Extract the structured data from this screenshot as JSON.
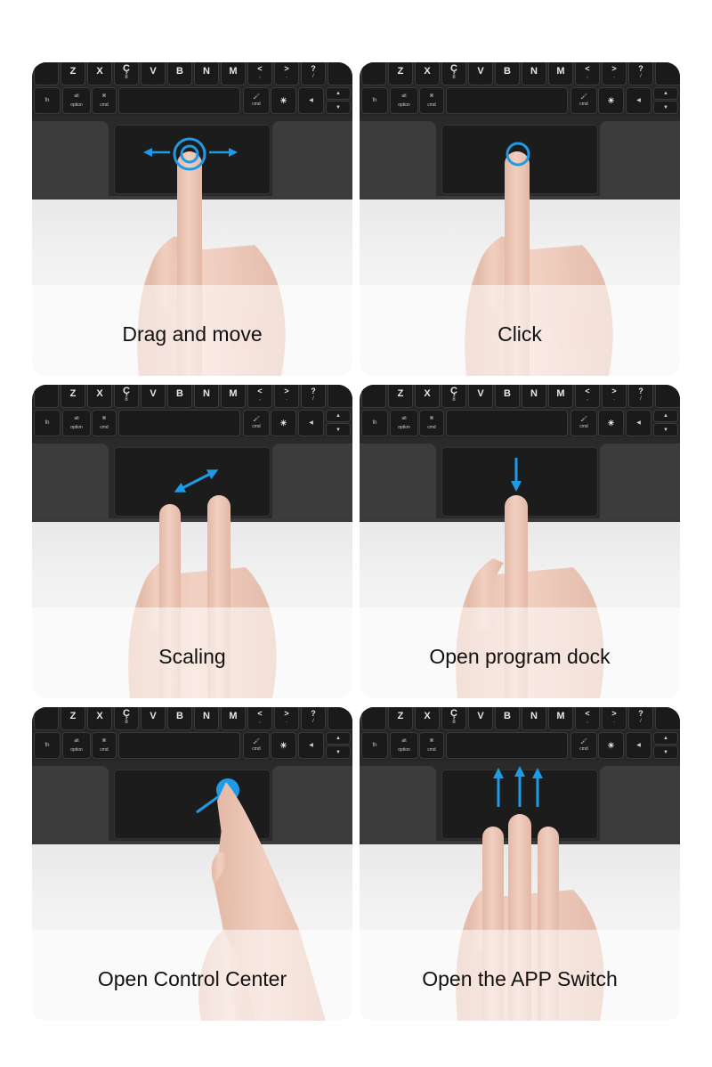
{
  "keyboard": {
    "row1": [
      {
        "main": "",
        "sub": ""
      },
      {
        "main": "Z",
        "sub": ""
      },
      {
        "main": "X",
        "sub": ""
      },
      {
        "main": "Ç",
        "sub": "8"
      },
      {
        "main": "V",
        "sub": ""
      },
      {
        "main": "B",
        "sub": ""
      },
      {
        "main": "N",
        "sub": ""
      },
      {
        "main": "M",
        "sub": ""
      },
      {
        "main": "<",
        "sub": ","
      },
      {
        "main": ">",
        "sub": "."
      },
      {
        "main": "?",
        "sub": "/"
      },
      {
        "main": "",
        "sub": ""
      }
    ],
    "row2": {
      "fn": "fn",
      "alt_top": "alt",
      "alt_bottom": "option",
      "cmd_symbol": "⌘",
      "cmd_label": "cmd",
      "right_cmd_icon": "🖌",
      "right_cmd_label": "cmd",
      "brightness_icon": "☀",
      "left_arrow": "◀",
      "up_arrow": "▲",
      "down_arrow": "▼"
    }
  },
  "accent_color": "#1e9be6",
  "gestures": [
    {
      "caption": "Drag and move",
      "gesture": "one-finger-drag"
    },
    {
      "caption": "Click",
      "gesture": "one-finger-tap"
    },
    {
      "caption": "Scaling",
      "gesture": "two-finger-pinch"
    },
    {
      "caption": "Open program dock",
      "gesture": "one-finger-swipe-down"
    },
    {
      "caption": "Open Control Center",
      "gesture": "one-finger-swipe-corner"
    },
    {
      "caption": "Open the APP Switch",
      "gesture": "three-finger-swipe-up"
    }
  ]
}
